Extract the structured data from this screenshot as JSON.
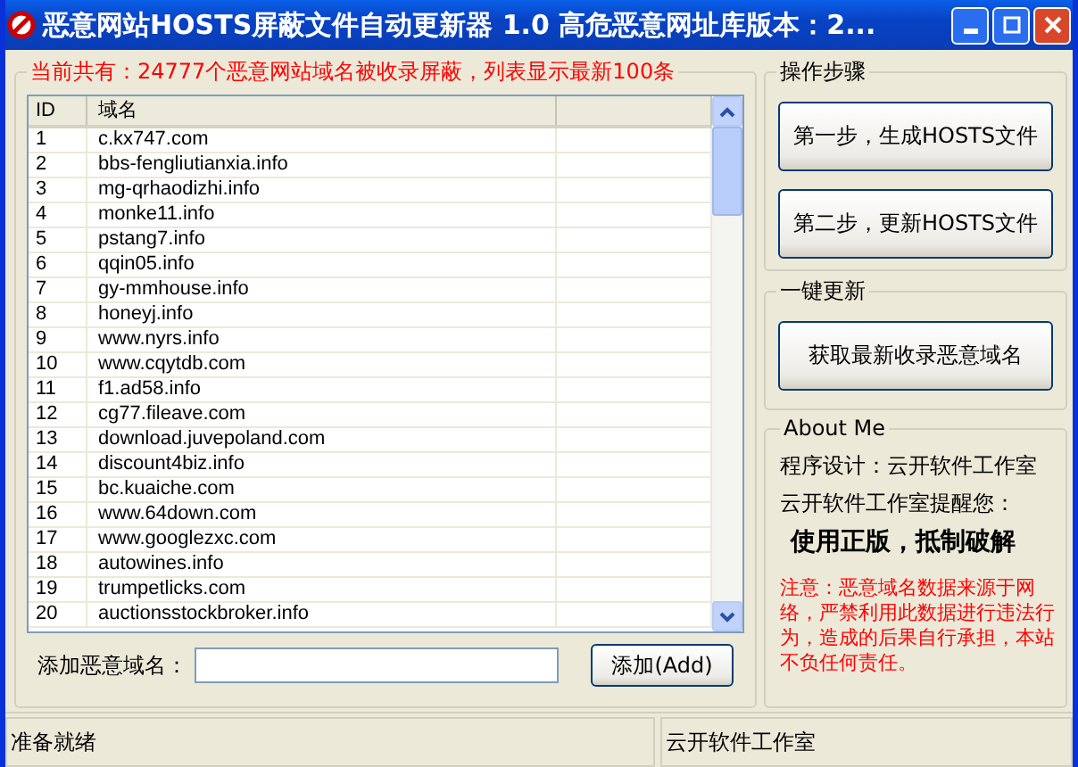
{
  "window": {
    "title": "恶意网站HOSTS屏蔽文件自动更新器 1.0 高危恶意网址库版本：2..."
  },
  "list_group": {
    "title": "当前共有：24777个恶意网站域名被收录屏蔽，列表显示最新100条"
  },
  "table": {
    "columns": [
      "ID",
      "域名"
    ],
    "rows": [
      [
        "1",
        "c.kx747.com"
      ],
      [
        "2",
        "bbs-fengliutianxia.info"
      ],
      [
        "3",
        "mg-qrhaodizhi.info"
      ],
      [
        "4",
        "monke11.info"
      ],
      [
        "5",
        "pstang7.info"
      ],
      [
        "6",
        "qqin05.info"
      ],
      [
        "7",
        "gy-mmhouse.info"
      ],
      [
        "8",
        "honeyj.info"
      ],
      [
        "9",
        "www.nyrs.info"
      ],
      [
        "10",
        "www.cqytdb.com"
      ],
      [
        "11",
        "f1.ad58.info"
      ],
      [
        "12",
        "cg77.fileave.com"
      ],
      [
        "13",
        "download.juvepoland.com"
      ],
      [
        "14",
        "discount4biz.info"
      ],
      [
        "15",
        "bc.kuaiche.com"
      ],
      [
        "16",
        "www.64down.com"
      ],
      [
        "17",
        "www.googlezxc.com"
      ],
      [
        "18",
        "autowines.info"
      ],
      [
        "19",
        "trumpetlicks.com"
      ],
      [
        "20",
        "auctionsstockbroker.info"
      ]
    ]
  },
  "add": {
    "label": "添加恶意域名：",
    "button": "添加(Add)"
  },
  "steps_group": {
    "title": "操作步骤",
    "buttons": [
      "第一步，生成HOSTS文件",
      "第二步，更新HOSTS文件"
    ]
  },
  "update_group": {
    "title": "一键更新",
    "button": "获取最新收录恶意域名"
  },
  "about_group": {
    "title": "About Me",
    "lines": [
      "程序设计：云开软件工作室",
      "云开软件工作室提醒您："
    ],
    "slogan": "使用正版，抵制破解",
    "notice": "注意：恶意域名数据来源于网络，严禁利用此数据进行违法行为，造成的后果自行承担，本站不负任何责任。"
  },
  "status_bar": [
    "准备就绪",
    "云开软件工作室"
  ]
}
